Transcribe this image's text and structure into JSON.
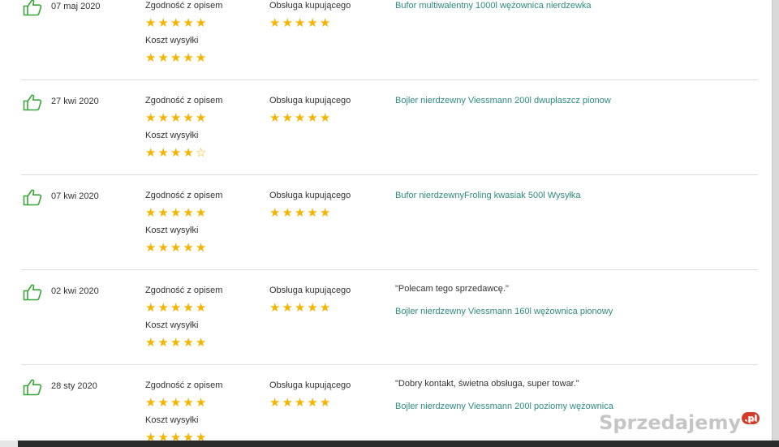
{
  "labels": {
    "accuracy": "Zgodność z opisem",
    "service": "Obsługa kupującego",
    "shipping": "Koszt wysyłki"
  },
  "colors": {
    "star": "#f4b400",
    "thumb": "#3aa53a",
    "product_link": "#2e8b7f"
  },
  "reviews": [
    {
      "date": "07 maj 2020",
      "comment": "",
      "product": "Bufor multiwalentny 1000l wężownica nierdzewka",
      "ratings": {
        "accuracy": 5,
        "service": 5,
        "shipping": 5
      }
    },
    {
      "date": "27 kwi 2020",
      "comment": "",
      "product": "Bojler nierdzewny Viessmann 200l dwupłaszcz pionow",
      "ratings": {
        "accuracy": 5,
        "service": 5,
        "shipping": 4
      }
    },
    {
      "date": "07 kwi 2020",
      "comment": "",
      "product": "Bufor nierdzewnyFroling kwasiak 500l Wysyłka",
      "ratings": {
        "accuracy": 5,
        "service": 5,
        "shipping": 5
      }
    },
    {
      "date": "02 kwi 2020",
      "comment": "\"Polecam tego sprzedawcę.\"",
      "product": "Bojler nierdzewny Viessmann 160l wężownica pionowy",
      "ratings": {
        "accuracy": 5,
        "service": 5,
        "shipping": 5
      }
    },
    {
      "date": "28 sty 2020",
      "comment": "\"Dobry kontakt, świetna obsługa, super towar.\"",
      "product": "Bojler nierdzewny Viessmann 200l poziomy wężownica",
      "ratings": {
        "accuracy": 5,
        "service": 5,
        "shipping": 5
      }
    }
  ],
  "watermark": {
    "text": "Sprzedajemy",
    "badge": ".pl"
  }
}
